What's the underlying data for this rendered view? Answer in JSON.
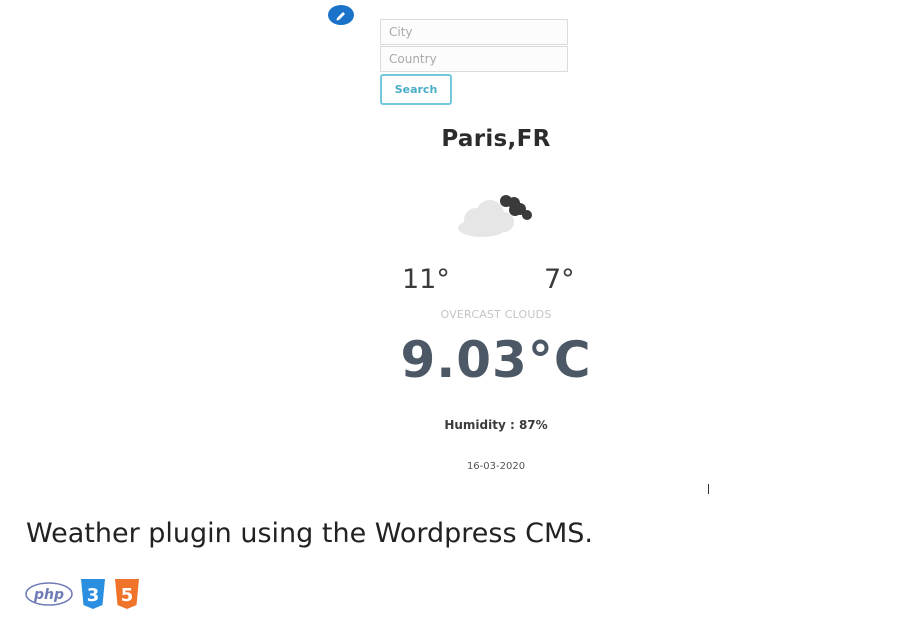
{
  "search": {
    "city_placeholder": "City",
    "country_placeholder": "Country",
    "button_label": "Search"
  },
  "weather": {
    "location": "Paris,FR",
    "icon": "cloud-icon",
    "temp_max": "11°",
    "temp_min": "7°",
    "condition": "OVERCAST CLOUDS",
    "temp_current": "9.03°C",
    "humidity": "Humidity : 87%",
    "date": "16-03-2020"
  },
  "caption": "Weather plugin using the Wordpress CMS.",
  "tech_badges": [
    {
      "name": "php-icon",
      "label": "php",
      "color": "#6f7bb6"
    },
    {
      "name": "css3-icon",
      "label": "3",
      "color": "#2a8fe0"
    },
    {
      "name": "html5-icon",
      "label": "5",
      "color": "#f0732a"
    }
  ],
  "colors": {
    "edit_button": "#1a73c9",
    "search_border": "#75c8dc",
    "temp_current": "#4d5866"
  }
}
